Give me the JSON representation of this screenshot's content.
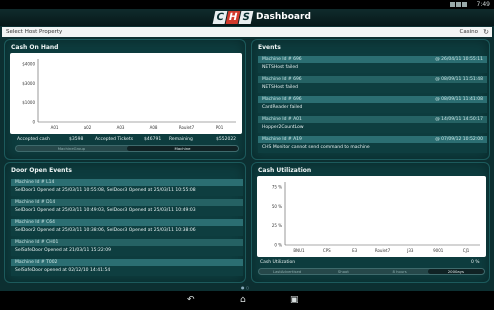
{
  "status": {
    "time": "7:49"
  },
  "app": {
    "logo": [
      "C",
      "H",
      "S"
    ],
    "title": "Dashboard"
  },
  "property": {
    "placeholder": "Select Host Property",
    "value": "Casino"
  },
  "cash_on_hand": {
    "title": "Cash On Hand",
    "accepted_cash_label": "Accepted cash",
    "accepted_cash_value": "$3598",
    "accepted_tickets_label": "Accepted Tickets",
    "accepted_tickets_value": "$46791",
    "remaining_label": "Remaining",
    "remaining_value": "$552022",
    "toggle": [
      "MachineGroup",
      "Machine"
    ],
    "toggle_selected": "Machine"
  },
  "cash_utilization": {
    "title": "Cash Utilization",
    "label": "Cash Utilization",
    "value": "0 %",
    "toggle": [
      "LastAdvertised",
      "Shoot",
      "8 hours",
      "2000ays"
    ],
    "toggle_selected": "2000ays"
  },
  "events": {
    "title": "Events",
    "items": [
      {
        "machine": "Machine Id # 696",
        "time": "@ 26/04/11 10:55:11",
        "message": "NETSHost failed"
      },
      {
        "machine": "Machine Id # 696",
        "time": "@ 08/09/11 11:51:48",
        "message": "NETSHost failed"
      },
      {
        "machine": "Machine Id # 696",
        "time": "@ 08/09/11 11:41:08",
        "message": "CardReader failed"
      },
      {
        "machine": "Machine Id # A01",
        "time": "@ 14/09/11 14:50:17",
        "message": "Hopper2CountLow"
      },
      {
        "machine": "Machine Id # A19",
        "time": "@ 07/09/12 10:52:00",
        "message": "CHS Monitor cannot send command to machine"
      }
    ]
  },
  "door_open": {
    "title": "Door Open Events",
    "items": [
      {
        "machine": "Machine Id # L14",
        "message": "SelDoor1 Opened at 25/03/11 10:55:08, SelDoor3 Opened at 25/03/11 10:55:08"
      },
      {
        "machine": "Machine Id # D14",
        "message": "SelDoor1 Opened at 25/03/11 10:49:03, SelDoor3 Opened at 25/03/11 10:49:03"
      },
      {
        "machine": "Machine Id # C64",
        "message": "SelDoor2 Opened at 25/03/11 10:38:06, SelDoor3 Opened at 25/03/11 10:38:06"
      },
      {
        "machine": "Machine Id # CH01",
        "message": "SelSafeDoor Opened at 21/03/11 15:22:09"
      },
      {
        "machine": "Machine Id # T002",
        "message": "SelSafeDoor opened at 02/12/10 14:41:54"
      }
    ]
  },
  "chart_data": [
    {
      "type": "bar",
      "title": "",
      "categories": [
        "A01",
        "a02",
        "A03",
        "A08",
        "Roulet7",
        "P01"
      ],
      "values": [
        0,
        0,
        0,
        0,
        0,
        0
      ],
      "yticks": [
        "0",
        "$1000",
        "$3000",
        "$4000"
      ],
      "ylim": [
        0,
        4000
      ],
      "grid": false
    },
    {
      "type": "bar",
      "title": "",
      "categories": [
        "BNU1",
        "CPS",
        "E3",
        "Roulet7",
        "J33",
        "9001",
        "CJ1"
      ],
      "values": [
        0,
        0,
        0,
        0,
        0,
        0,
        0
      ],
      "yticks": [
        "0 %",
        "25 %",
        "50 %",
        "75 %"
      ],
      "ylim": [
        0,
        100
      ],
      "grid": false
    }
  ],
  "icons": {
    "refresh": "refresh-icon",
    "back": "back-icon",
    "home": "home-icon",
    "recent": "recent-apps-icon"
  }
}
